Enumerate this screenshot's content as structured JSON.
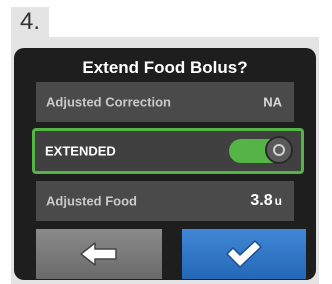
{
  "step": {
    "label": "4."
  },
  "screen": {
    "title": "Extend Food Bolus?",
    "rows": [
      {
        "label": "Adjusted Correction",
        "value": "NA"
      },
      {
        "label": "EXTENDED",
        "toggle_on": true
      },
      {
        "label": "Adjusted Food",
        "value": "3.8",
        "unit": "u"
      }
    ]
  },
  "buttons": {
    "back_icon": "left-arrow-icon",
    "confirm_icon": "checkmark-icon"
  },
  "colors": {
    "screen_bg": "#1e1e1e",
    "row_bg": "#4a4a4a",
    "accent_green": "#55b446",
    "confirm_blue": "#2f78c8",
    "back_gray": "#7a7a7a"
  }
}
